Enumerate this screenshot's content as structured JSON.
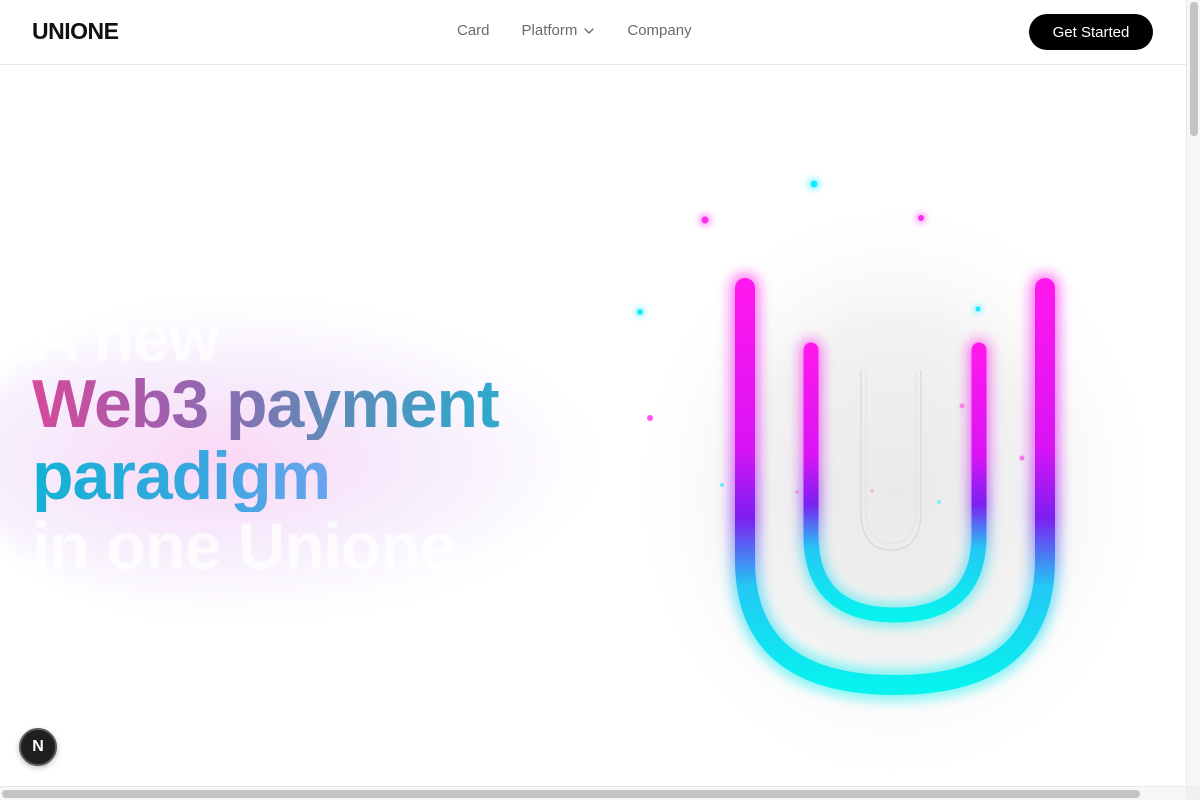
{
  "header": {
    "logo": "UNIONE",
    "nav": {
      "card": "Card",
      "platform": "Platform",
      "company": "Company"
    },
    "cta_label": "Get Started"
  },
  "hero": {
    "ghost_top": "A new",
    "headline_line1": "Web3 payment",
    "headline_line2": "paradigm",
    "ghost_bottom": "in one Unione"
  },
  "badge": {
    "letter": "N"
  },
  "colors": {
    "magenta": "#ff1fe6",
    "cyan": "#10f0f0",
    "violet": "#8a1cf0",
    "cta_bg": "#000000"
  },
  "icons": {
    "platform_dropdown": "chevron-down-icon",
    "hero_art": "u-logo-icon"
  }
}
